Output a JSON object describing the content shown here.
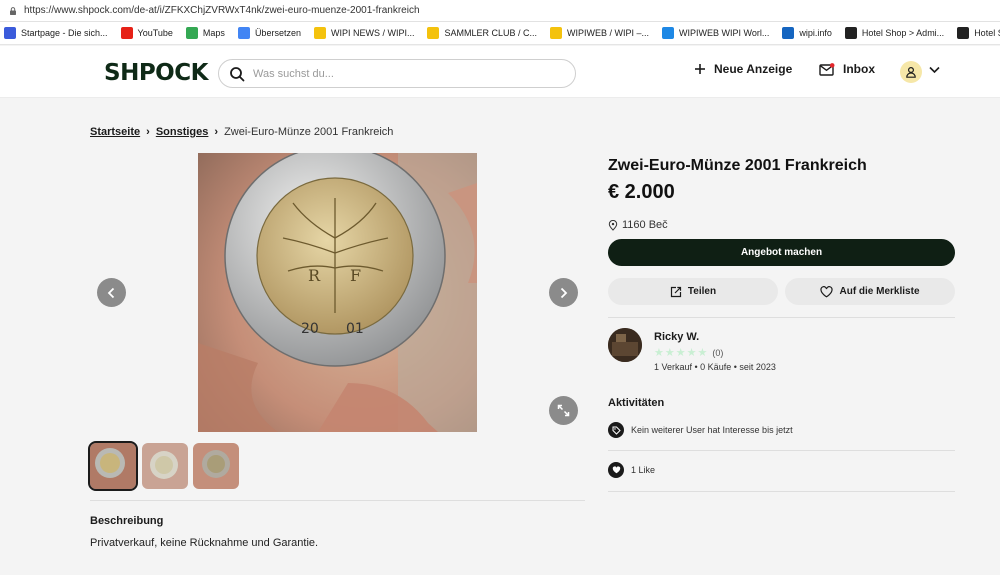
{
  "browser": {
    "url": "https://www.shpock.com/de-at/i/ZFKXChjZVRWxT4nk/zwei-euro-muenze-2001-frankreich",
    "bookmarks": [
      {
        "label": "Startpage - Die sich...",
        "icon": "startpage-icon",
        "color": "#3b5bdb"
      },
      {
        "label": "YouTube",
        "icon": "youtube-icon",
        "color": "#e62117"
      },
      {
        "label": "Maps",
        "icon": "maps-icon",
        "color": "#34a853"
      },
      {
        "label": "Übersetzen",
        "icon": "translate-icon",
        "color": "#4285f4"
      },
      {
        "label": "WIPI NEWS / WIPI...",
        "icon": "wipi-icon",
        "color": "#f4c20d"
      },
      {
        "label": "SAMMLER CLUB / C...",
        "icon": "wipi-icon",
        "color": "#f4c20d"
      },
      {
        "label": "WIPIWEB / WIPI –...",
        "icon": "wipi-icon",
        "color": "#f4c20d"
      },
      {
        "label": "WIPIWEB WIPI Worl...",
        "icon": "wipiweb-icon",
        "color": "#1e88e5"
      },
      {
        "label": "wipi.info",
        "icon": "wipi-info-icon",
        "color": "#1565c0"
      },
      {
        "label": "Hotel Shop > Admi...",
        "icon": "hotel-shop-icon",
        "color": "#222222"
      },
      {
        "label": "Hotel Shop",
        "icon": "hotel-shop-icon",
        "color": "#222222"
      }
    ]
  },
  "header": {
    "logo": "SHPOCK",
    "search_placeholder": "Was suchst du...",
    "new_listing": "Neue Anzeige",
    "inbox": "Inbox"
  },
  "breadcrumb": {
    "home": "Startseite",
    "category": "Sonstiges",
    "current": "Zwei-Euro-Münze 2001 Frankreich"
  },
  "listing": {
    "title": "Zwei-Euro-Münze 2001 Frankreich",
    "price": "€ 2.000",
    "location": "1160 Beč",
    "offer_button": "Angebot machen",
    "share_button": "Teilen",
    "watchlist_button": "Auf die Merkliste",
    "description_title": "Beschreibung",
    "description": "Privatverkauf, keine Rücknahme und Garantie."
  },
  "seller": {
    "name": "Ricky W.",
    "rating_count": "(0)",
    "stats": "1 Verkauf • 0 Käufe • seit 2023"
  },
  "activities": {
    "title": "Aktivitäten",
    "interest": "Kein weiterer User hat Interesse bis jetzt",
    "likes": "1 Like"
  },
  "colors": {
    "brand_dark": "#0f1f14",
    "background": "#f4f4f4",
    "pill": "#e9e9e9"
  }
}
